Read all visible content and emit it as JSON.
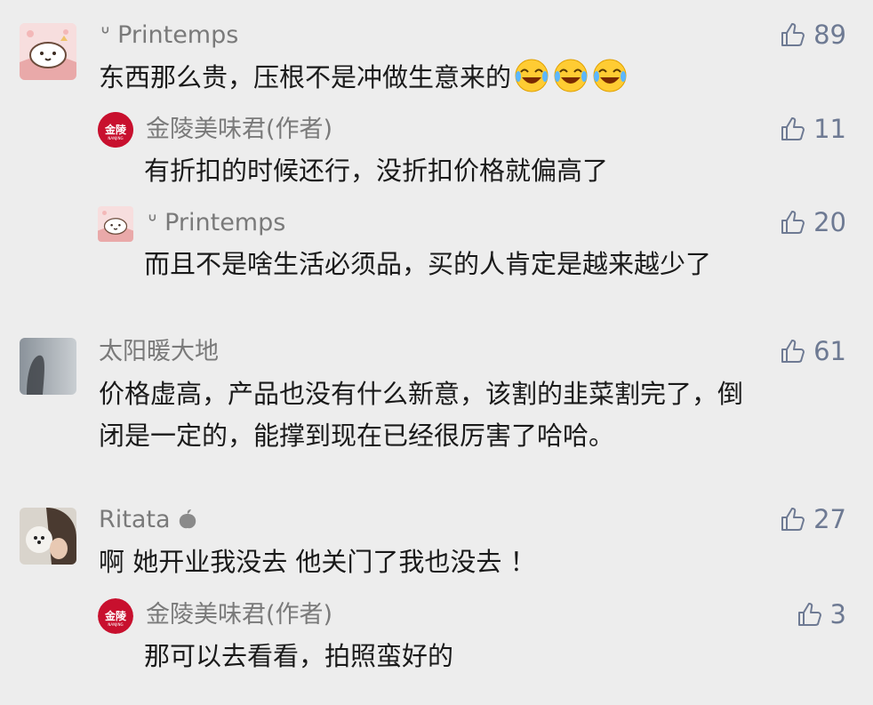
{
  "colors": {
    "background": "#ededed",
    "name_text": "#7a7a7a",
    "body_text": "#1a1a1a",
    "like_text": "#6e7a93",
    "author_avatar": "#c8102e"
  },
  "author_avatar_text": "金陵",
  "comments": [
    {
      "user": "ᐡ Printemps",
      "text": "东西那么贵，压根不是冲做生意来的",
      "emojis": [
        "laugh-cry-emoji",
        "laugh-cry-emoji",
        "laugh-cry-emoji"
      ],
      "likes": "89",
      "replies": [
        {
          "user": "金陵美味君(作者)",
          "text": "有折扣的时候还行，没折扣价格就偏高了",
          "likes": "11"
        },
        {
          "user": "ᐡ Printemps",
          "text": "而且不是啥生活必须品，买的人肯定是越来越少了",
          "likes": "20"
        }
      ]
    },
    {
      "user": "太阳暖大地",
      "text_lines": [
        "价格虚高，产品也没有什么新意，该割的韭菜割完了，倒",
        "闭是一定的，能撑到现在已经很厉害了哈哈。"
      ],
      "likes": "61"
    },
    {
      "user": "Ritata",
      "user_icon": "peach-icon",
      "text": "啊 她开业我没去 他关门了我也没去 ！",
      "likes": "27",
      "replies": [
        {
          "user": "金陵美味君(作者)",
          "text": "那可以去看看，拍照蛮好的",
          "likes": "3"
        }
      ]
    }
  ]
}
